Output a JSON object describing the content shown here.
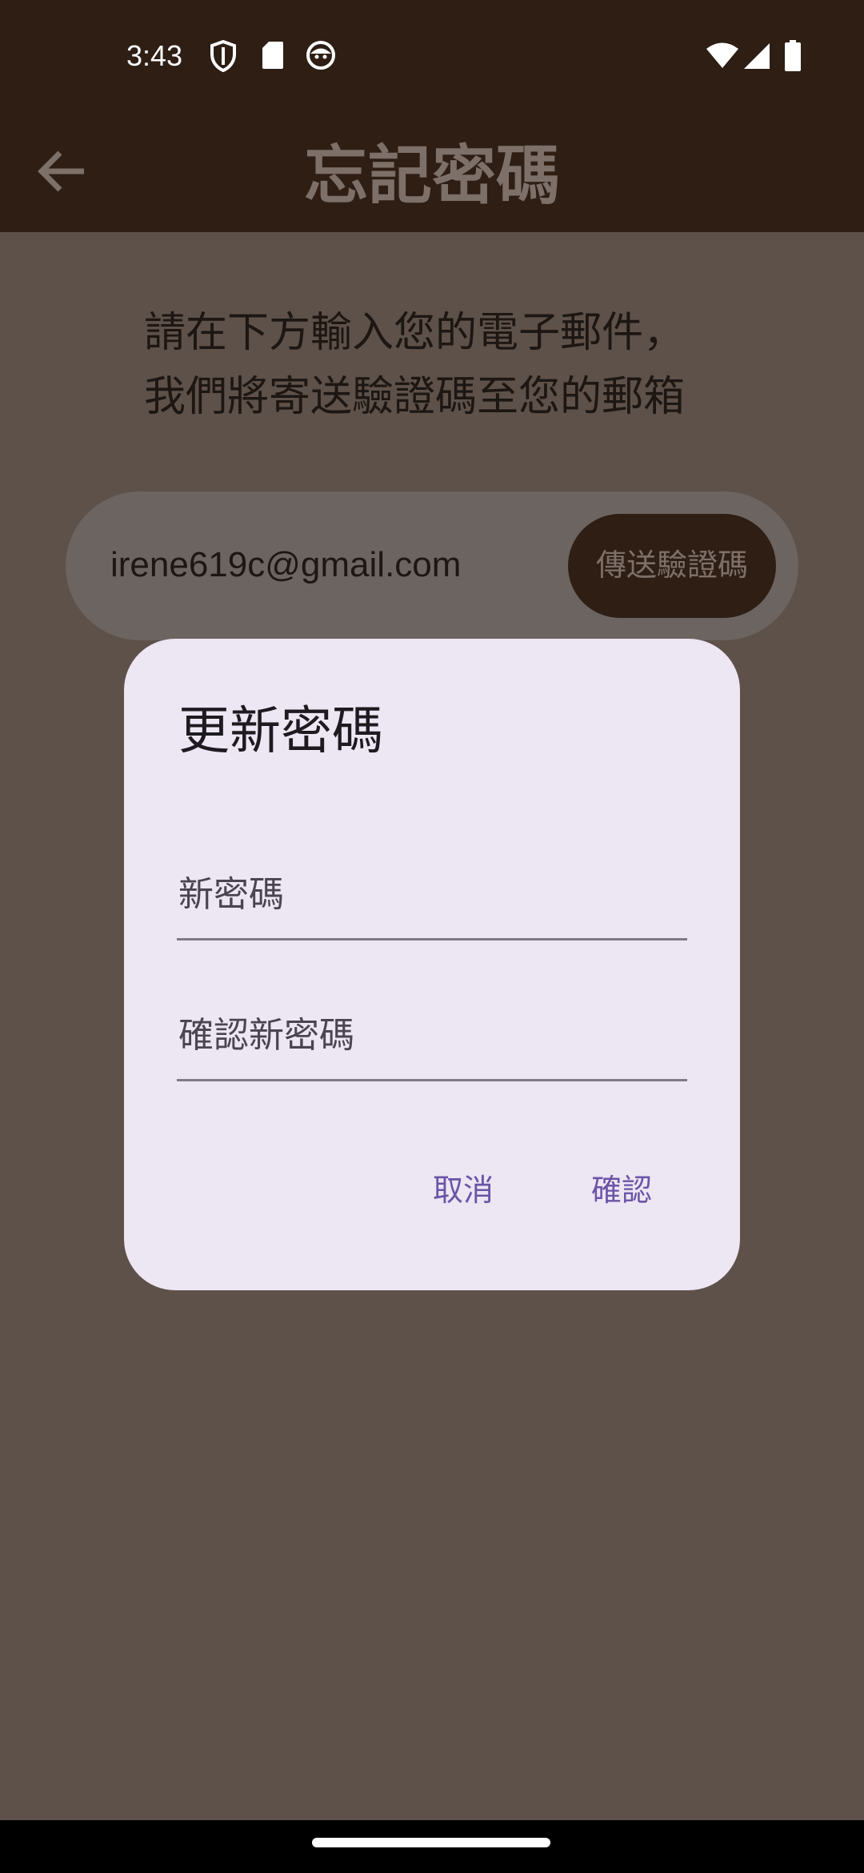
{
  "status_bar": {
    "time": "3:43",
    "icons": [
      "shield-icon",
      "sd-card-icon",
      "face-icon",
      "wifi-icon",
      "signal-icon",
      "battery-icon"
    ]
  },
  "app_bar": {
    "title": "忘記密碼",
    "back_icon": "arrow-back-icon"
  },
  "main": {
    "instruction_line1": "請在下方輸入您的電子郵件，",
    "instruction_line2": "我們將寄送驗證碼至您的郵箱",
    "email_value": "irene619c@gmail.com",
    "send_code_label": "傳送驗證碼"
  },
  "dialog": {
    "title": "更新密碼",
    "new_password_label": "新密碼",
    "confirm_password_label": "確認新密碼",
    "cancel_label": "取消",
    "confirm_label": "確認"
  },
  "colors": {
    "status_bar": "#2e1e14",
    "scrim_background": "#5d5149",
    "dialog_background": "#ede6f3",
    "dialog_action": "#6a54a6"
  }
}
